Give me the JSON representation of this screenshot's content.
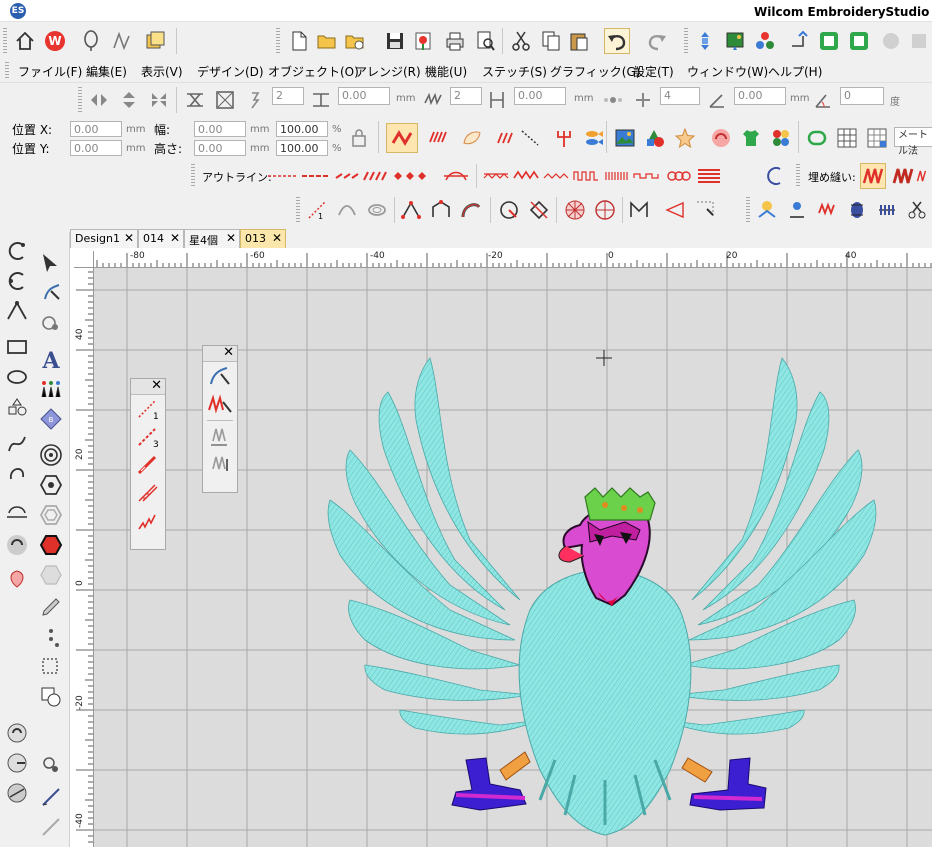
{
  "window": {
    "title": "Wilcom EmbroideryStudio - デザ",
    "logo_text": "ES"
  },
  "menu": [
    "ファイル(F)",
    "編集(E)",
    "表示(V)",
    "デザイン(D)",
    "オブジェクト(O)",
    "アレンジ(R)",
    "機能(U)",
    "ステッチ(S)",
    "グラフィック(G)",
    "設定(T)",
    "ウィンドウ(W)",
    "ヘルプ(H)"
  ],
  "transform_bar": {
    "field1": "2",
    "field2": "0.00",
    "unit_mm": "mm",
    "field3": "2",
    "field4": "0.00",
    "field5": "4",
    "field6": "0.00",
    "field7": "0",
    "degree": "度"
  },
  "position_bar": {
    "pos_x_label": "位置 X:",
    "pos_y_label": "位置 Y:",
    "pos_x": "0.00",
    "pos_y": "0.00",
    "width_label": "幅:",
    "height_label": "高さ:",
    "width": "0.00",
    "height": "0.00",
    "width_pct": "100.00",
    "height_pct": "100.00",
    "unit": "mm",
    "pct": "%",
    "metric_select": "メートル法"
  },
  "outline_bar": {
    "label": "アウトライン:"
  },
  "fill_bar": {
    "label": "埋め縫い:"
  },
  "tabs": [
    {
      "label": "Design1",
      "active": false
    },
    {
      "label": "014",
      "active": false
    },
    {
      "label": "星4個",
      "active": false
    },
    {
      "label": "013",
      "active": true
    }
  ],
  "ruler": {
    "h_labels": [
      "-80",
      "-60",
      "-40",
      "-20",
      "0",
      "20",
      "40"
    ],
    "v_labels": [
      "40",
      "20",
      "0",
      "-20",
      "-40"
    ]
  },
  "colors": {
    "accent": "#fbe7ab",
    "canvas": "#dcdcdc",
    "wing": "#8fe6e3",
    "beak": "#d94bd0",
    "crown": "#6bd04a",
    "feet": "#3b1fd0"
  }
}
